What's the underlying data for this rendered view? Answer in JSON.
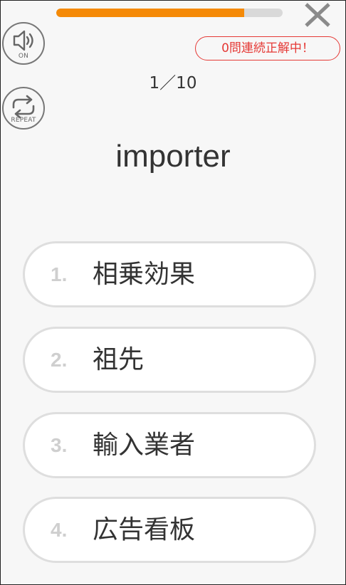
{
  "progress": {
    "current": 1,
    "total": 10,
    "fraction": 0.83,
    "fill_color": "#f58a07"
  },
  "counter": {
    "text": "1／10"
  },
  "sound": {
    "caption": "ON"
  },
  "repeat": {
    "caption": "REPEAT"
  },
  "streak": {
    "text": "0問連続正解中！",
    "color": "#e53935"
  },
  "question": {
    "word": "importer"
  },
  "choices": [
    {
      "number": "1.",
      "label": "相乗効果"
    },
    {
      "number": "2.",
      "label": "祖先"
    },
    {
      "number": "3.",
      "label": "輸入業者"
    },
    {
      "number": "4.",
      "label": "広告看板"
    }
  ],
  "icons": {
    "close": "close-icon",
    "sound": "speaker-icon",
    "repeat": "repeat-icon"
  }
}
